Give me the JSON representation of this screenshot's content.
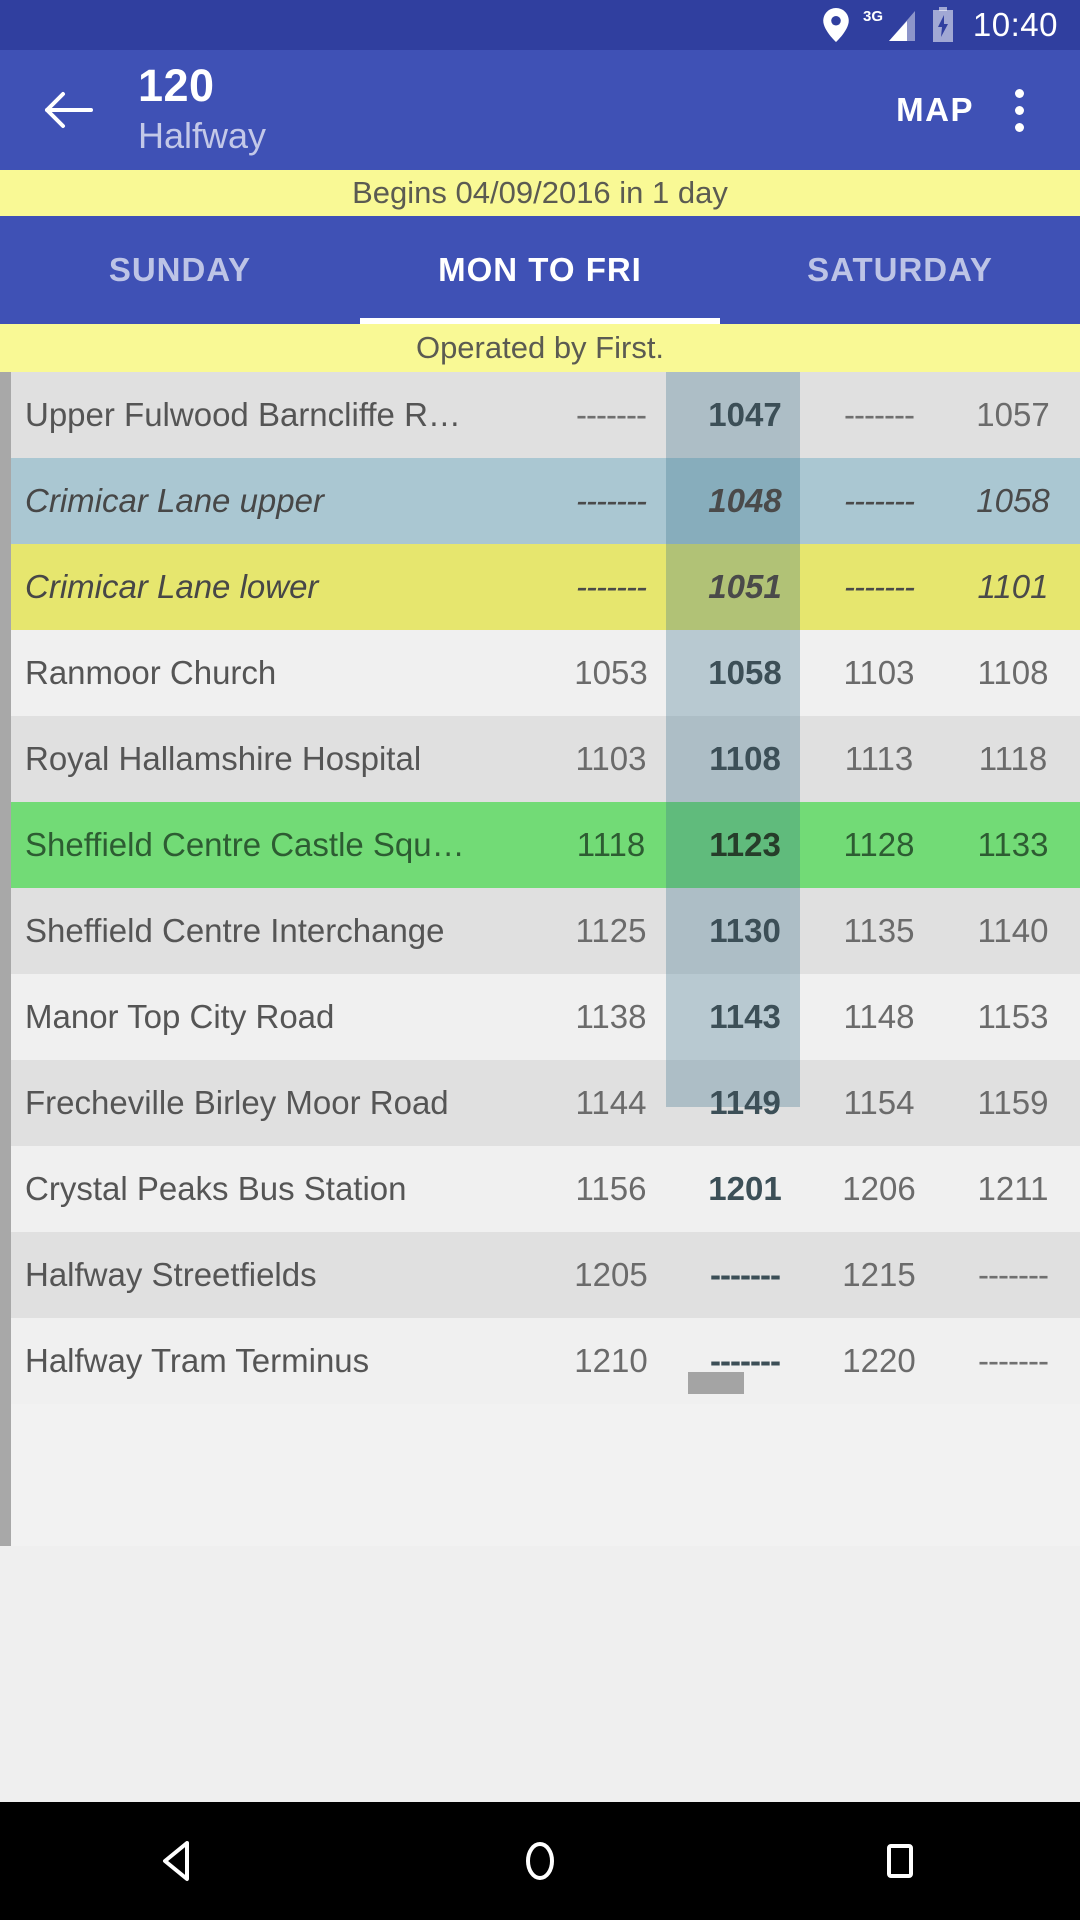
{
  "status_bar": {
    "icons": [
      "location-pin-icon",
      "signal-3g-icon",
      "battery-charging-icon"
    ],
    "network_label": "3G",
    "time": "10:40"
  },
  "app_bar": {
    "back_label": "back-arrow",
    "route_number": "120",
    "destination": "Halfway",
    "map_label": "MAP",
    "overflow_label": "more-options"
  },
  "banners": {
    "begins": "Begins 04/09/2016 in 1 day",
    "operator": "Operated by First."
  },
  "tabs": [
    {
      "label": "SUNDAY",
      "active": false
    },
    {
      "label": "MON TO FRI",
      "active": true
    },
    {
      "label": "SATURDAY",
      "active": false
    }
  ],
  "timetable": {
    "selected_column_index": 1,
    "rows": [
      {
        "stop": "Upper Fulwood Barncliffe R…",
        "times": [
          "-------",
          "1047",
          "-------",
          "1057"
        ],
        "style": "odd"
      },
      {
        "stop": "Crimicar Lane upper",
        "times": [
          "-------",
          "1048",
          "-------",
          "1058"
        ],
        "style": "hl-blue"
      },
      {
        "stop": "Crimicar Lane lower",
        "times": [
          "-------",
          "1051",
          "-------",
          "1101"
        ],
        "style": "hl-yellow"
      },
      {
        "stop": "Ranmoor Church",
        "times": [
          "1053",
          "1058",
          "1103",
          "1108"
        ],
        "style": "even"
      },
      {
        "stop": "Royal Hallamshire Hospital",
        "times": [
          "1103",
          "1108",
          "1113",
          "1118"
        ],
        "style": "odd"
      },
      {
        "stop": "Sheffield Centre Castle Squ…",
        "times": [
          "1118",
          "1123",
          "1128",
          "1133"
        ],
        "style": "hl-green"
      },
      {
        "stop": "Sheffield Centre Interchange",
        "times": [
          "1125",
          "1130",
          "1135",
          "1140"
        ],
        "style": "odd"
      },
      {
        "stop": "Manor Top City Road",
        "times": [
          "1138",
          "1143",
          "1148",
          "1153"
        ],
        "style": "even"
      },
      {
        "stop": "Frecheville Birley Moor Road",
        "times": [
          "1144",
          "1149",
          "1154",
          "1159"
        ],
        "style": "odd"
      },
      {
        "stop": "Crystal Peaks Bus Station",
        "times": [
          "1156",
          "1201",
          "1206",
          "1211"
        ],
        "style": "even"
      },
      {
        "stop": "Halfway Streetfields",
        "times": [
          "1205",
          "-------",
          "1215",
          "-------"
        ],
        "style": "odd"
      },
      {
        "stop": "Halfway Tram Terminus",
        "times": [
          "1210",
          "-------",
          "1220",
          "-------"
        ],
        "style": "even"
      }
    ]
  },
  "nav_bar": {
    "back": "back-triangle",
    "home": "home-circle",
    "recents": "recents-square"
  },
  "colors": {
    "status_bar": "#303f9f",
    "app_bar": "#3f51b5",
    "banner_yellow": "#f9f995",
    "row_highlight_blue": "#aac7d2",
    "row_highlight_yellow": "#e6e66e",
    "row_highlight_green": "#72db76"
  }
}
